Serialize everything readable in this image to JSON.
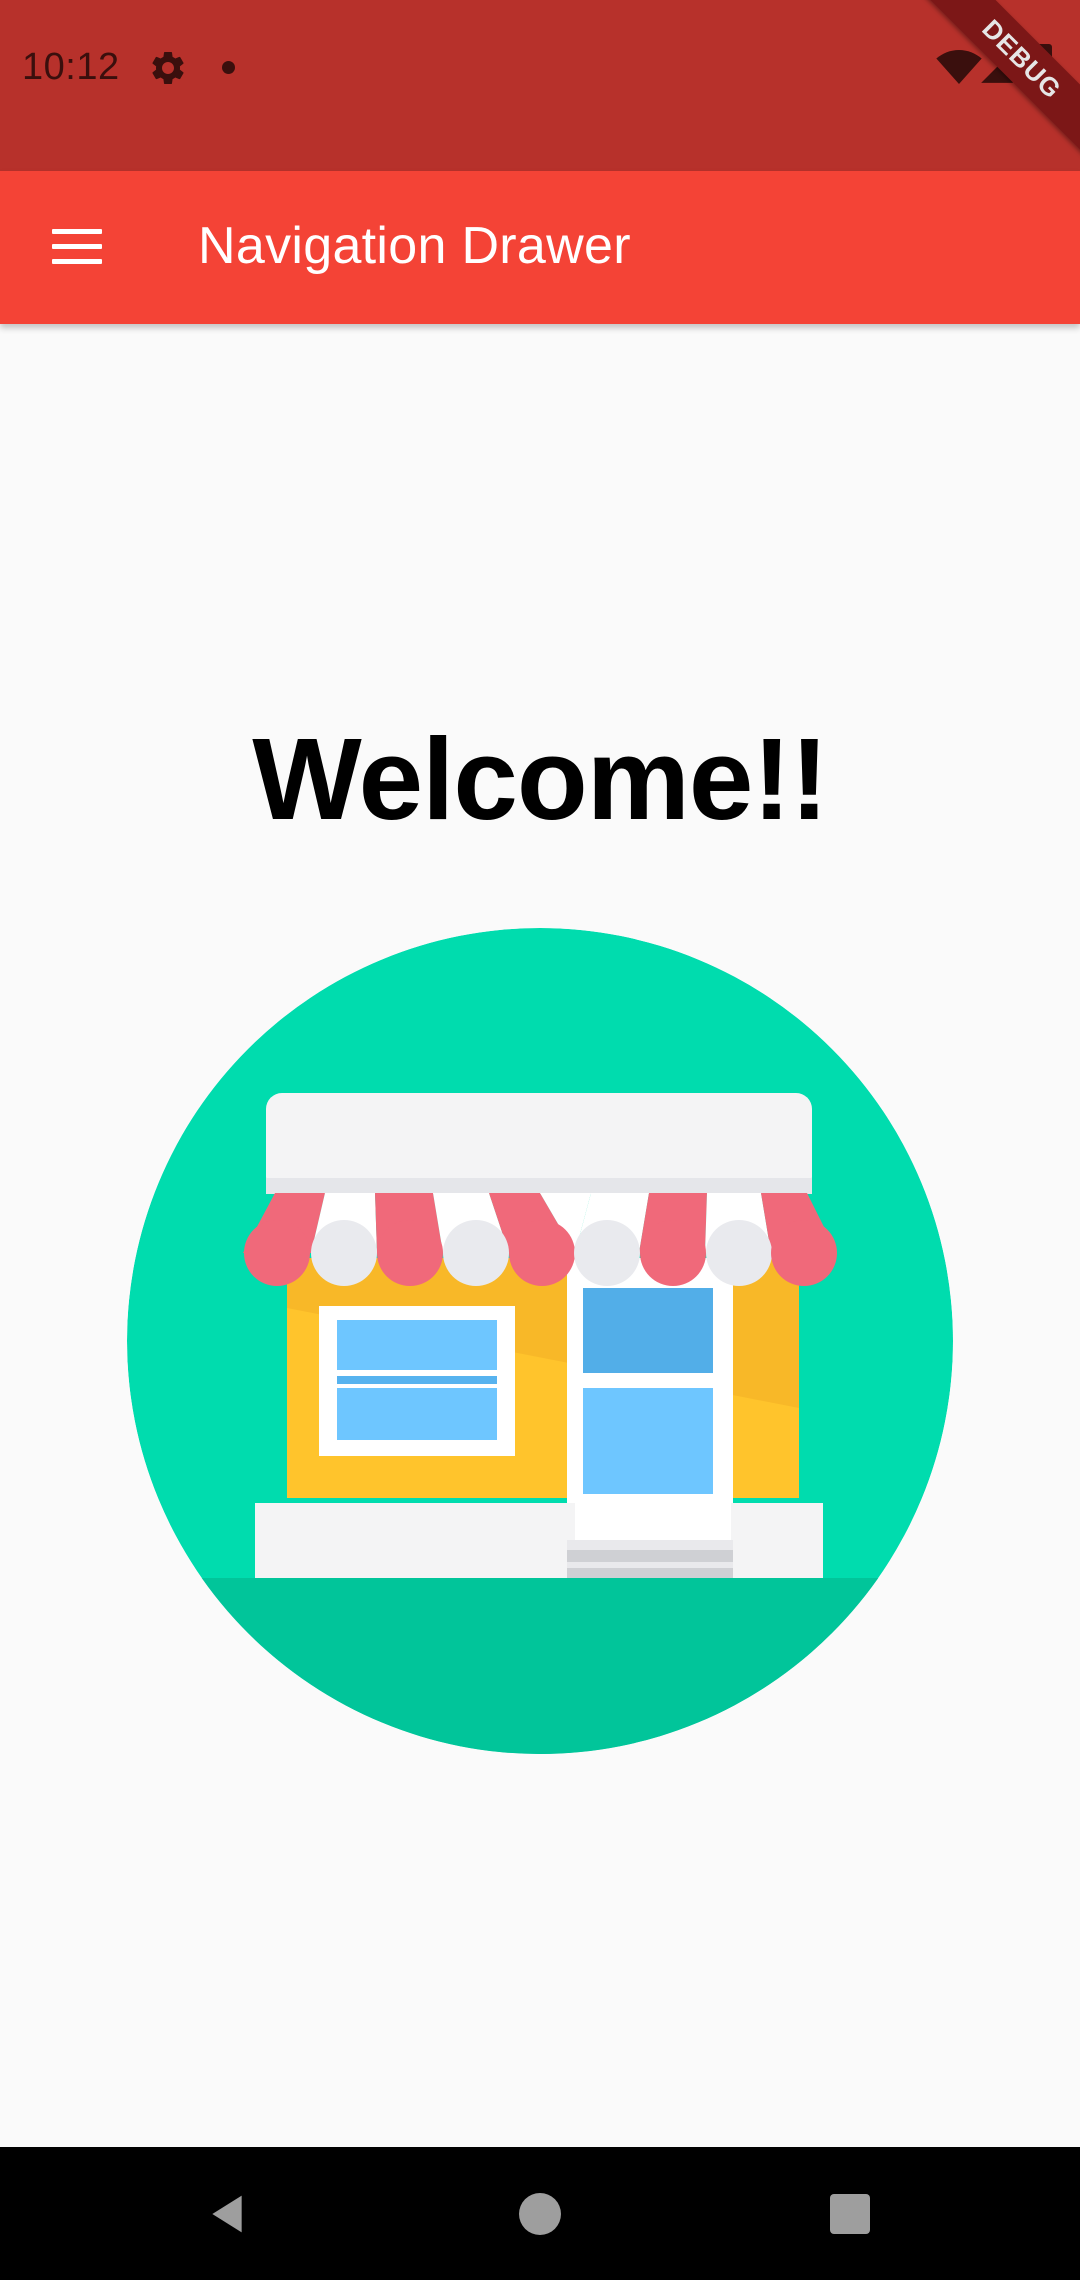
{
  "status_bar": {
    "time": "10:12",
    "color": "#b7312b",
    "icons": [
      "gear-icon",
      "notification-dot-icon",
      "wifi-icon",
      "signal-icon",
      "battery-icon"
    ]
  },
  "debug_banner": {
    "label": "DEBUG"
  },
  "app_bar": {
    "title": "Navigation Drawer",
    "color": "#f44336",
    "menu_icon": "hamburger-menu-icon"
  },
  "main": {
    "heading": "Welcome!!",
    "illustration": "storefront-illustration"
  },
  "nav_bar": {
    "icons": [
      "back-icon",
      "home-icon",
      "recents-icon"
    ]
  }
}
